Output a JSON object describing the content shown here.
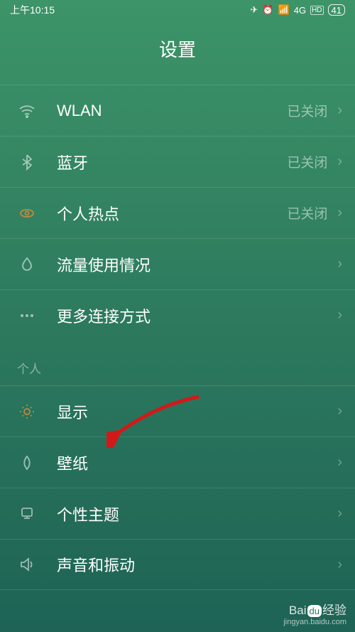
{
  "status_bar": {
    "time": "上午10:15",
    "network": "4G",
    "battery": "41"
  },
  "page": {
    "title": "设置"
  },
  "sections": {
    "wireless": {
      "wlan": {
        "label": "WLAN",
        "value": "已关闭"
      },
      "bluetooth": {
        "label": "蓝牙",
        "value": "已关闭"
      },
      "hotspot": {
        "label": "个人热点",
        "value": "已关闭"
      },
      "data_usage": {
        "label": "流量使用情况"
      },
      "more": {
        "label": "更多连接方式"
      }
    },
    "personal": {
      "header": "个人",
      "display": {
        "label": "显示"
      },
      "wallpaper": {
        "label": "壁纸"
      },
      "theme": {
        "label": "个性主题"
      },
      "sound": {
        "label": "声音和振动"
      }
    }
  },
  "watermark": {
    "brand_left": "Bai",
    "brand_mid": "du",
    "brand_right": "经验",
    "url": "jingyan.baidu.com"
  }
}
